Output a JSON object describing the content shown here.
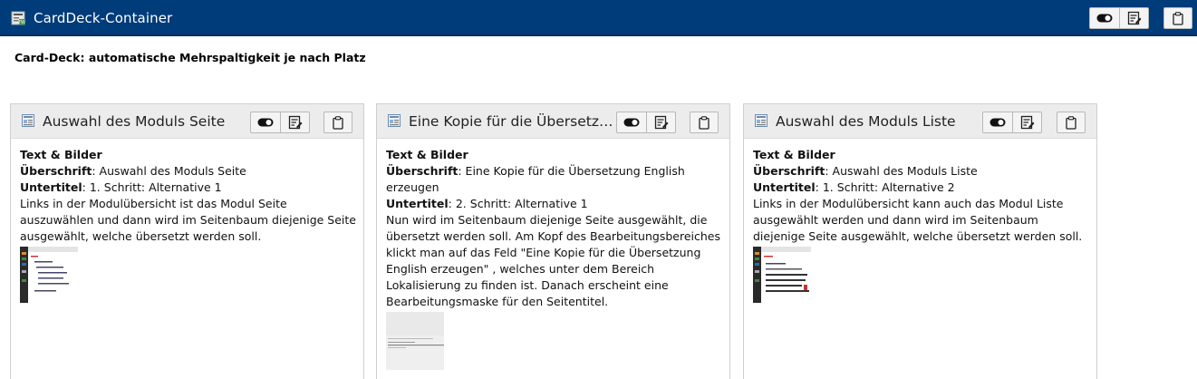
{
  "header": {
    "title": "CardDeck-Container",
    "icons": [
      "page-content-icon",
      "toggle-visibility-icon",
      "edit-icon",
      "clipboard-icon"
    ]
  },
  "intro": "Card-Deck: automatische Mehrspaltigkeit je nach Platz",
  "cards": [
    {
      "title": "Auswahl des Moduls Seite",
      "type_label": "Text & Bilder",
      "heading_label": "Überschrift",
      "heading_value": ": Auswahl des Moduls Seite",
      "subtitle_label": "Untertitel",
      "subtitle_value": ": 1. Schritt: Alternative 1",
      "text": "Links in der Modulübersicht ist das Modul Seite auszuwählen und dann wird im Seitenbaum diejenige Seite ausgewählt, welche übersetzt werden soll."
    },
    {
      "title": "Eine Kopie für die Übersetzu...",
      "type_label": "Text & Bilder",
      "heading_label": "Überschrift",
      "heading_value": ": Eine Kopie für die Übersetzung English erzeugen",
      "subtitle_label": "Untertitel",
      "subtitle_value": ": 2. Schritt: Alternative 1",
      "text": "Nun wird im Seitenbaum diejenige Seite ausgewählt, die übersetzt werden soll. Am Kopf des Bearbeitungsbereiches klickt man auf das Feld \"Eine Kopie für die Übersetzung English erzeugen\" , welches unter dem Bereich Lokalisierung zu finden ist. Danach erscheint eine Bearbeitungsmaske für den Seitentitel."
    },
    {
      "title": "Auswahl des Moduls Liste",
      "type_label": "Text & Bilder",
      "heading_label": "Überschrift",
      "heading_value": ": Auswahl des Moduls Liste",
      "subtitle_label": "Untertitel",
      "subtitle_value": ": 1. Schritt: Alternative 2",
      "text": "Links in der Modulübersicht kann auch das Modul Liste ausgewählt werden und dann wird im Seitenbaum diejenige Seite ausgewählt, welche übersetzt werden soll."
    }
  ],
  "colors": {
    "topbar": "#003b7a",
    "card_header": "#ececec"
  }
}
